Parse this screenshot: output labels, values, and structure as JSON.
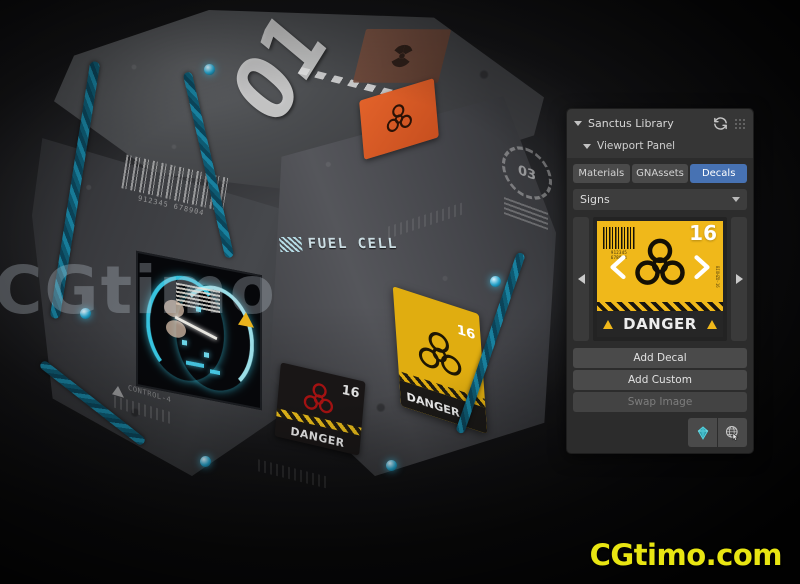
{
  "panel": {
    "title": "Sanctus Library",
    "sub_title": "Viewport Panel",
    "sync_icon": "refresh-icon",
    "grip_icon": "drag-grip-icon",
    "tabs": [
      {
        "label": "Materials",
        "active": false
      },
      {
        "label": "GNAssets",
        "active": false
      },
      {
        "label": "Decals",
        "active": true
      }
    ],
    "category_dropdown": {
      "value": "Signs",
      "chevron_icon": "chevron-down-icon"
    },
    "preview": {
      "prev_icon": "arrow-left-icon",
      "next_icon": "arrow-right-icon",
      "decal": {
        "number": "16",
        "barcode_number": "912345 678904",
        "side_code": "BIOHZD-16",
        "caption": "DANGER",
        "warning_icon": "warning-triangle-icon",
        "biohazard_icon": "biohazard-icon",
        "background_color": "#f0b81a"
      }
    },
    "buttons": [
      {
        "label": "Add Decal",
        "disabled": false
      },
      {
        "label": "Add Custom",
        "disabled": false
      },
      {
        "label": "Swap Image",
        "disabled": true
      }
    ],
    "icon_buttons": [
      {
        "name": "gem-asset-icon",
        "color": "#3fbfc9"
      },
      {
        "name": "globe-cursor-icon",
        "color": "#cfcfcf"
      }
    ],
    "accent_color": "#4772b3",
    "background_color": "#2c2c2c"
  },
  "viewport": {
    "object_name": "sci-fi-crate",
    "crate_decals": {
      "fuel_cell_label": "FUEL CELL",
      "stencil_number": "01",
      "barcode_number": "912345 678904",
      "seal_number": "03",
      "red_decal": {
        "number": "16",
        "caption": "DANGER"
      },
      "yellow_decal": {
        "number": "16",
        "caption": "DANGER"
      },
      "bottom_label": "CONTROL-4"
    }
  },
  "watermarks": {
    "left": "CGtimo",
    "bottom": "CGtimo.com",
    "bottom_color": "#e8e512"
  }
}
